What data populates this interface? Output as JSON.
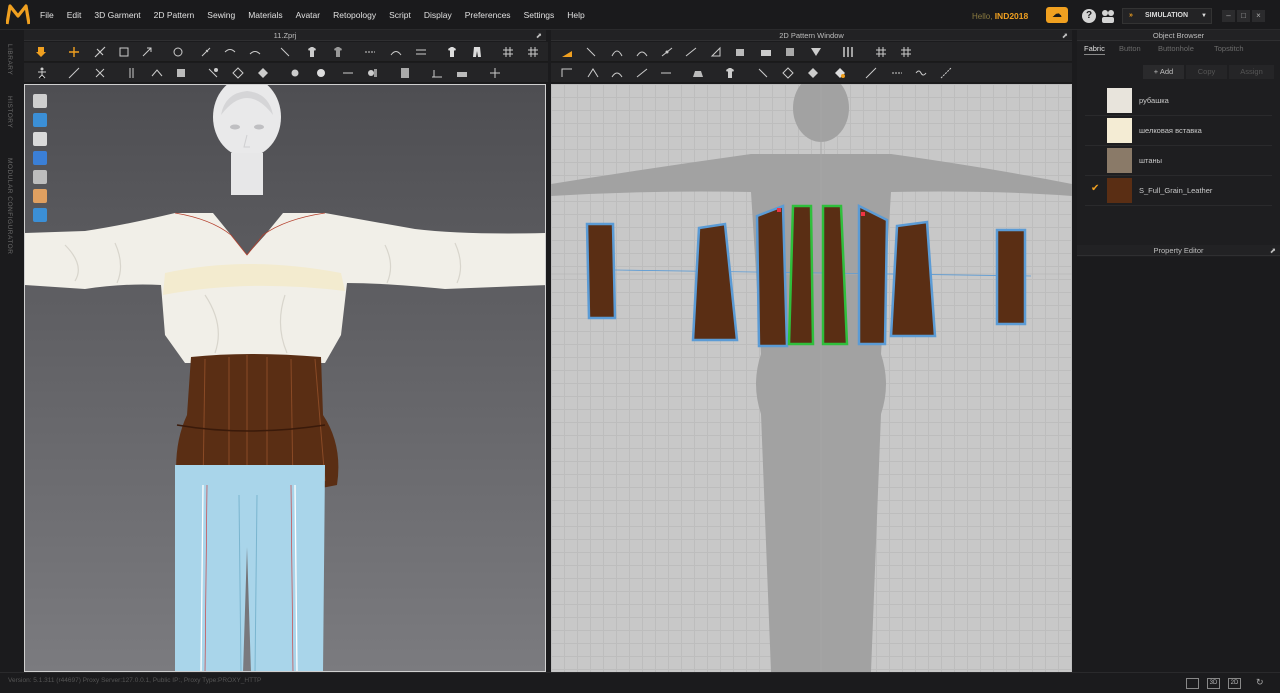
{
  "app": {
    "logo_text": "M",
    "menu": [
      "File",
      "Edit",
      "3D Garment",
      "2D Pattern",
      "Sewing",
      "Materials",
      "Avatar",
      "Retopology",
      "Script",
      "Display",
      "Preferences",
      "Settings",
      "Help"
    ],
    "greeting": "Hello,",
    "username": "IND2018",
    "mode": "SIMULATION",
    "help_icon": "question-icon",
    "window_min": "–",
    "window_max": "□",
    "window_close": "×"
  },
  "sidebar_labels": [
    "LIBRARY",
    "HISTORY",
    "MODULAR CONFIGURATOR"
  ],
  "viewport3d": {
    "title": "11.Zprj"
  },
  "viewport2d": {
    "title": "2D Pattern Window"
  },
  "object_browser": {
    "title": "Object Browser",
    "tabs": [
      "Fabric",
      "Button",
      "Buttonhole",
      "Topstitch"
    ],
    "active_tab": "Fabric",
    "actions": [
      "+ Add",
      "Copy",
      "Assign"
    ],
    "fabrics": [
      {
        "name": "рубашка",
        "color": "#e8e4dc",
        "checked": false
      },
      {
        "name": "шелковая вставка",
        "color": "#f4ecd4",
        "checked": false
      },
      {
        "name": "штаны",
        "color": "#8a7a68",
        "checked": false
      },
      {
        "name": "S_Full_Grain_Leather",
        "color": "#5a2e14",
        "checked": true
      }
    ]
  },
  "property_editor": {
    "title": "Property Editor"
  },
  "status": {
    "text": "Version: 5.1.311 (r44697)     Proxy Server:127.0.0.1, Public IP:, Proxy Type:PROXY_HTTP"
  },
  "view_buttons": [
    "",
    "3D",
    "2D"
  ],
  "colors": {
    "accent": "#f0a020",
    "pattern_outline": "#5b9bd5",
    "selected_outline": "#2fbf3c",
    "leather": "#5a2e14",
    "shirt": "#f1efe8",
    "pants": "#a9d5ea"
  }
}
